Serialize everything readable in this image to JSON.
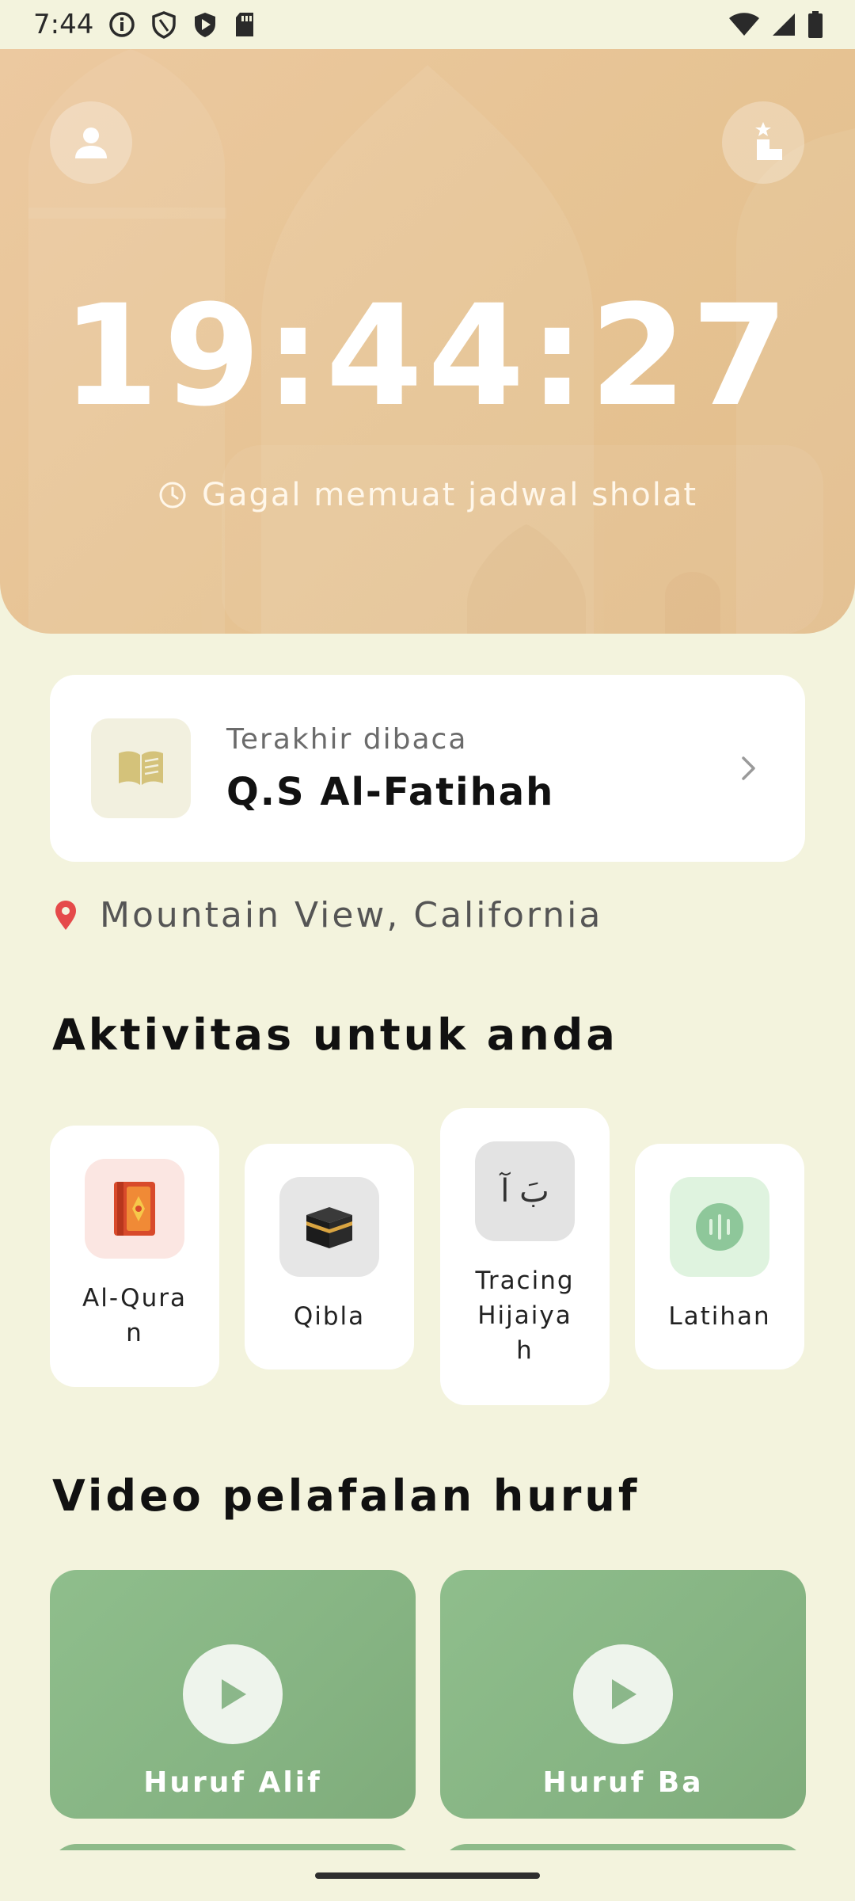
{
  "status_bar": {
    "time": "7:44",
    "icons_left": [
      "info-icon",
      "shield-icon",
      "play-shield-icon",
      "sd-card-icon"
    ],
    "icons_right": [
      "wifi-icon",
      "signal-icon",
      "battery-icon"
    ]
  },
  "header": {
    "clock": "19:44:27",
    "schedule_text": "Gagal memuat jadwal sholat",
    "bg_color": "#e6c393"
  },
  "last_read": {
    "label": "Terakhir dibaca",
    "title": "Q.S Al-Fatihah"
  },
  "location": {
    "text": "Mountain View, California",
    "pin_color": "#e54a4a"
  },
  "activities": {
    "title": "Aktivitas untuk anda",
    "items": [
      {
        "label": "Al-Quran",
        "icon": "quran-book-icon"
      },
      {
        "label": "Qibla",
        "icon": "kaaba-icon"
      },
      {
        "label": "Tracing Hijaiyah",
        "icon": "hijaiyah-tracing-icon",
        "glyph": "بَ آ"
      },
      {
        "label": "Latihan",
        "icon": "audio-wave-icon"
      }
    ]
  },
  "videos": {
    "title": "Video pelafalan huruf",
    "items": [
      {
        "label": "Huruf Alif"
      },
      {
        "label": "Huruf Ba"
      }
    ]
  },
  "colors": {
    "background": "#f3f3dd",
    "video_green": "#8dba89",
    "accent_gold": "#d4c27a"
  }
}
